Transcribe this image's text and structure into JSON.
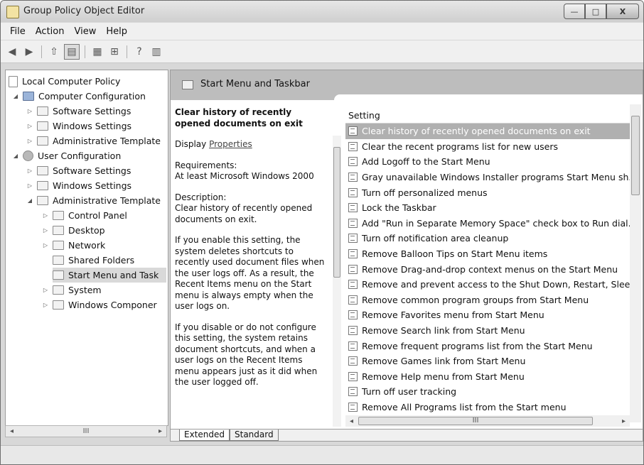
{
  "window": {
    "title": "Group Policy Object Editor",
    "buttons": {
      "minimize": "—",
      "maximize": "□",
      "close": "X"
    }
  },
  "menu": [
    "File",
    "Action",
    "View",
    "Help"
  ],
  "toolbar": {
    "back": "◀",
    "forward": "▶",
    "up": "⇧",
    "show_hide": "▤",
    "export": "▦",
    "properties": "⊞",
    "help": "?",
    "extended": "▥"
  },
  "tree": [
    {
      "label": "Local Computer Policy"
    },
    {
      "label": "Computer Configuration"
    },
    {
      "label": "Software Settings"
    },
    {
      "label": "Windows Settings"
    },
    {
      "label": "Administrative Template"
    },
    {
      "label": "User Configuration"
    },
    {
      "label": "Software Settings"
    },
    {
      "label": "Windows Settings"
    },
    {
      "label": "Administrative Template"
    },
    {
      "label": "Control Panel"
    },
    {
      "label": "Desktop"
    },
    {
      "label": "Network"
    },
    {
      "label": "Shared Folders"
    },
    {
      "label": "Start Menu and Task"
    },
    {
      "label": "System"
    },
    {
      "label": "Windows Componer"
    }
  ],
  "tree_scroll": {
    "left": "◂",
    "thumb": "III",
    "right": "▸"
  },
  "header": {
    "title": "Start Menu and Taskbar"
  },
  "description": {
    "title": "Clear history of recently opened documents on exit",
    "display_prefix": "Display",
    "display_link": "Properties",
    "requirements_label": "Requirements:",
    "requirements_value": "At least Microsoft Windows 2000",
    "description_label": "Description:",
    "description_text": "Clear history of recently opened documents on exit.",
    "enable_text": "If you enable this setting, the system deletes shortcuts to recently used document files when the user logs off. As a result, the Recent Items menu on the Start menu is always empty when the user logs on.",
    "disable_text": "If you disable or do not configure this setting, the system retains document shortcuts, and when a user logs on the Recent Items menu appears just as it did when the user logged off."
  },
  "list": {
    "header": "Setting",
    "items": [
      "Clear history of recently opened documents on exit",
      "Clear the recent programs list for new users",
      "Add Logoff to the Start Menu",
      "Gray unavailable Windows Installer programs Start Menu sh...",
      "Turn off personalized menus",
      "Lock the Taskbar",
      "Add \"Run in Separate Memory Space\" check box to Run dial...",
      "Turn off notification area cleanup",
      "Remove Balloon Tips on Start Menu items",
      "Remove Drag-and-drop context menus on the Start Menu",
      "Remove and prevent access to the Shut Down, Restart, Sleep...",
      "Remove common program groups from Start Menu",
      "Remove Favorites menu from Start Menu",
      "Remove Search link from Start Menu",
      "Remove frequent programs list from the Start Menu",
      "Remove Games link from Start Menu",
      "Remove Help menu from Start Menu",
      "Turn off user tracking",
      "Remove All Programs list from the Start menu"
    ]
  },
  "list_scroll": {
    "left": "◂",
    "thumb": "III",
    "right": "▸"
  },
  "tabs": [
    "Extended",
    "Standard"
  ]
}
